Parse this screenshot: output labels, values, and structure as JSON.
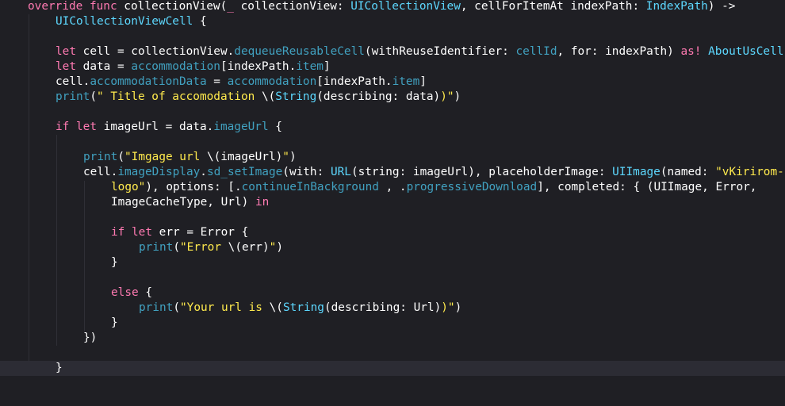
{
  "editor": {
    "lines": [
      {
        "tokens": [
          {
            "t": "override",
            "c": "kw"
          },
          {
            "t": " ",
            "c": "plain"
          },
          {
            "t": "func",
            "c": "kw"
          },
          {
            "t": " collectionView(",
            "c": "plain"
          },
          {
            "t": "_",
            "c": "kw"
          },
          {
            "t": " collectionView: ",
            "c": "plain"
          },
          {
            "t": "UICollectionView",
            "c": "type"
          },
          {
            "t": ", cellForItemAt indexPath: ",
            "c": "plain"
          },
          {
            "t": "IndexPath",
            "c": "type"
          },
          {
            "t": ") ->",
            "c": "plain"
          }
        ]
      },
      {
        "tokens": [
          {
            "t": "UICollectionViewCell",
            "c": "type"
          },
          {
            "t": " {",
            "c": "plain"
          }
        ]
      },
      {
        "tokens": []
      },
      {
        "tokens": [
          {
            "t": "let",
            "c": "kw"
          },
          {
            "t": " cell = collectionView.",
            "c": "plain"
          },
          {
            "t": "dequeueReusableCell",
            "c": "fn"
          },
          {
            "t": "(withReuseIdentifier: ",
            "c": "plain"
          },
          {
            "t": "cellId",
            "c": "prop"
          },
          {
            "t": ", for: indexPath) ",
            "c": "plain"
          },
          {
            "t": "as!",
            "c": "kw"
          },
          {
            "t": " ",
            "c": "plain"
          },
          {
            "t": "AboutUsCell",
            "c": "type"
          }
        ]
      },
      {
        "tokens": [
          {
            "t": "let",
            "c": "kw"
          },
          {
            "t": " data = ",
            "c": "plain"
          },
          {
            "t": "accommodation",
            "c": "prop"
          },
          {
            "t": "[indexPath.",
            "c": "plain"
          },
          {
            "t": "item",
            "c": "prop"
          },
          {
            "t": "]",
            "c": "plain"
          }
        ]
      },
      {
        "tokens": [
          {
            "t": "cell.",
            "c": "plain"
          },
          {
            "t": "accommodationData",
            "c": "prop"
          },
          {
            "t": " = ",
            "c": "plain"
          },
          {
            "t": "accommodation",
            "c": "prop"
          },
          {
            "t": "[indexPath.",
            "c": "plain"
          },
          {
            "t": "item",
            "c": "prop"
          },
          {
            "t": "]",
            "c": "plain"
          }
        ]
      },
      {
        "tokens": [
          {
            "t": "print",
            "c": "fn"
          },
          {
            "t": "(",
            "c": "plain"
          },
          {
            "t": "\" Title of accomodation ",
            "c": "strq"
          },
          {
            "t": "\\(",
            "c": "interp"
          },
          {
            "t": "String",
            "c": "type"
          },
          {
            "t": "(describing: data)",
            "c": "plain"
          },
          {
            "t": ")\"",
            "c": "strq"
          },
          {
            "t": ")",
            "c": "plain"
          }
        ]
      },
      {
        "tokens": []
      },
      {
        "tokens": [
          {
            "t": "if",
            "c": "kw"
          },
          {
            "t": " ",
            "c": "plain"
          },
          {
            "t": "let",
            "c": "kw"
          },
          {
            "t": " imageUrl = data.",
            "c": "plain"
          },
          {
            "t": "imageUrl",
            "c": "prop"
          },
          {
            "t": " {",
            "c": "plain"
          }
        ]
      },
      {
        "tokens": []
      },
      {
        "tokens": [
          {
            "t": "print",
            "c": "fn"
          },
          {
            "t": "(",
            "c": "plain"
          },
          {
            "t": "\"Imgage url ",
            "c": "strq"
          },
          {
            "t": "\\(",
            "c": "interp"
          },
          {
            "t": "imageUrl)",
            "c": "plain"
          },
          {
            "t": "\"",
            "c": "strq"
          },
          {
            "t": ")",
            "c": "plain"
          }
        ]
      },
      {
        "tokens": [
          {
            "t": "cell.",
            "c": "plain"
          },
          {
            "t": "imageDisplay",
            "c": "prop"
          },
          {
            "t": ".",
            "c": "plain"
          },
          {
            "t": "sd_setImage",
            "c": "fn"
          },
          {
            "t": "(with: ",
            "c": "plain"
          },
          {
            "t": "URL",
            "c": "type"
          },
          {
            "t": "(string: imageUrl), placeholderImage: ",
            "c": "plain"
          },
          {
            "t": "UIImage",
            "c": "type"
          },
          {
            "t": "(named: ",
            "c": "plain"
          },
          {
            "t": "\"vKirirom-",
            "c": "strq"
          }
        ]
      },
      {
        "tokens": [
          {
            "t": "logo\"",
            "c": "strq"
          },
          {
            "t": "), options: [.",
            "c": "plain"
          },
          {
            "t": "continueInBackground",
            "c": "prop"
          },
          {
            "t": " , .",
            "c": "plain"
          },
          {
            "t": "progressiveDownload",
            "c": "prop"
          },
          {
            "t": "], completed: { (UIImage, Error,",
            "c": "plain"
          }
        ]
      },
      {
        "tokens": [
          {
            "t": "ImageCacheType, Url) ",
            "c": "plain"
          },
          {
            "t": "in",
            "c": "kw"
          }
        ]
      },
      {
        "tokens": []
      },
      {
        "tokens": [
          {
            "t": "if",
            "c": "kw"
          },
          {
            "t": " ",
            "c": "plain"
          },
          {
            "t": "let",
            "c": "kw"
          },
          {
            "t": " err = Error {",
            "c": "plain"
          }
        ]
      },
      {
        "tokens": [
          {
            "t": "print",
            "c": "fn"
          },
          {
            "t": "(",
            "c": "plain"
          },
          {
            "t": "\"Error ",
            "c": "strq"
          },
          {
            "t": "\\(",
            "c": "interp"
          },
          {
            "t": "err)",
            "c": "plain"
          },
          {
            "t": "\"",
            "c": "strq"
          },
          {
            "t": ")",
            "c": "plain"
          }
        ]
      },
      {
        "tokens": [
          {
            "t": "}",
            "c": "plain"
          }
        ]
      },
      {
        "tokens": []
      },
      {
        "tokens": [
          {
            "t": "else",
            "c": "kw"
          },
          {
            "t": " {",
            "c": "plain"
          }
        ]
      },
      {
        "tokens": [
          {
            "t": "print",
            "c": "fn"
          },
          {
            "t": "(",
            "c": "plain"
          },
          {
            "t": "\"Your url is ",
            "c": "strq"
          },
          {
            "t": "\\(",
            "c": "interp"
          },
          {
            "t": "String",
            "c": "type"
          },
          {
            "t": "(describing: Url)",
            "c": "plain"
          },
          {
            "t": ")\"",
            "c": "strq"
          },
          {
            "t": ")",
            "c": "plain"
          }
        ]
      },
      {
        "tokens": [
          {
            "t": "}",
            "c": "plain"
          }
        ]
      },
      {
        "tokens": [
          {
            "t": "})",
            "c": "plain"
          }
        ]
      },
      {
        "tokens": []
      },
      {
        "tokens": [
          {
            "t": "}",
            "c": "plain"
          }
        ]
      }
    ],
    "current_line": 24
  },
  "theme": {
    "background": "#1f1f24",
    "current_line": "#2c2c34",
    "keyword": "#ff7ab2",
    "type": "#5dd8ff",
    "property": "#41a1c0",
    "string": "#ffea4d",
    "plain": "#ffffff"
  }
}
